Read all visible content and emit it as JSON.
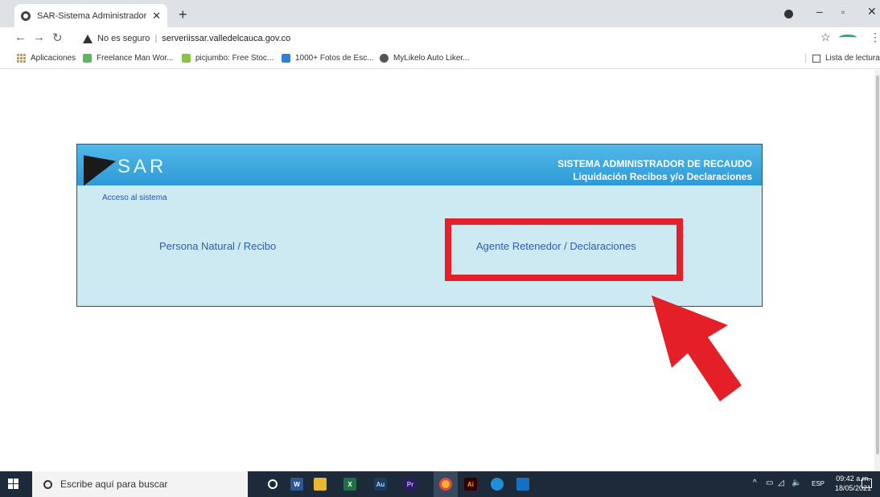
{
  "browser": {
    "tab_title": "SAR-Sistema Administrador de R",
    "tab_close": "✕",
    "new_tab": "+",
    "url_warning": "No es seguro",
    "url_separator": "|",
    "url_host": "serveriissar.valledelcauca.gov.co",
    "bookmarks": [
      {
        "label": "Aplicaciones",
        "icon": "apps-icon"
      },
      {
        "label": "Freelance Man Wor...",
        "icon": "freelance-icon",
        "color": "#5cb85c"
      },
      {
        "label": "picjumbo: Free Stoc...",
        "icon": "picjumbo-icon",
        "color": "#8bc34a"
      },
      {
        "label": "1000+ Fotos de Esc...",
        "icon": "photos-icon",
        "color": "#2f7fd6"
      },
      {
        "label": "MyLikelo Auto Liker...",
        "icon": "globe-icon",
        "color": "#555555"
      }
    ],
    "reading_list": "Lista de lectura"
  },
  "sar": {
    "logo_text": "SAR",
    "title_line1": "SISTEMA ADMINISTRADOR DE RECAUDO",
    "title_line2": "Liquidación Recibos y/o Declaraciones",
    "access_label": "Acceso al sistema",
    "link_persona": "Persona Natural / Recibo",
    "link_agente": "Agente Retenedor / Declaraciones"
  },
  "annotation": {
    "highlight_color": "#e51f27"
  },
  "taskbar": {
    "search_placeholder": "Escribe aquí para buscar",
    "apps": [
      {
        "icon": "cortana-icon",
        "label": "O",
        "color": "#1d2a3a"
      },
      {
        "icon": "word-icon",
        "label": "W",
        "color": "#2b5797"
      },
      {
        "icon": "explorer-icon",
        "label": "",
        "color": "#e8b830"
      },
      {
        "icon": "excel-icon",
        "label": "X",
        "color": "#1e7145"
      },
      {
        "icon": "audition-icon",
        "label": "Au",
        "color": "#1b3c5c"
      },
      {
        "icon": "premiere-icon",
        "label": "Pr",
        "color": "#2a1f5c"
      },
      {
        "icon": "chrome-icon",
        "label": "",
        "color": "#f2b233"
      },
      {
        "icon": "illustrator-icon",
        "label": "Ai",
        "color": "#330000"
      },
      {
        "icon": "edge-icon",
        "label": "",
        "color": "#1f8fd8"
      },
      {
        "icon": "mail-icon",
        "label": "",
        "color": "#1570c4"
      }
    ],
    "language": "ESP",
    "time": "09:42 a.m.",
    "date": "18/05/2021"
  }
}
